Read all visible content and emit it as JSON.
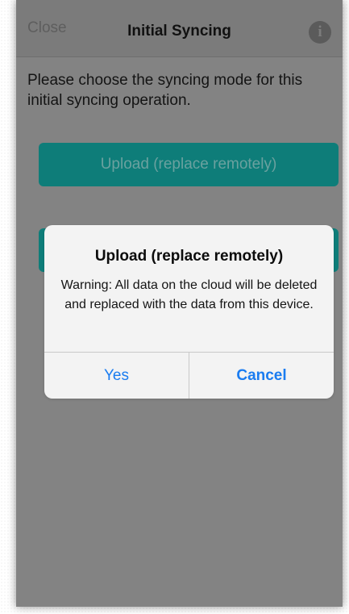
{
  "navbar": {
    "close_label": "Close",
    "title": "Initial Syncing",
    "info_icon_glyph": "i"
  },
  "prompt": {
    "text": "Please choose the syncing mode for this initial syncing operation."
  },
  "modes": [
    {
      "label": "Upload (replace remotely)"
    },
    {
      "label": ""
    }
  ],
  "alert": {
    "title": "Upload (replace remotely)",
    "message": "Warning: All data on the cloud will be deleted and replaced with the data from this device.",
    "yes_label": "Yes",
    "cancel_label": "Cancel"
  },
  "colors": {
    "accent_button": "#0e7d79",
    "alert_action": "#1a7cf0",
    "overlay_gray": "#838383"
  }
}
